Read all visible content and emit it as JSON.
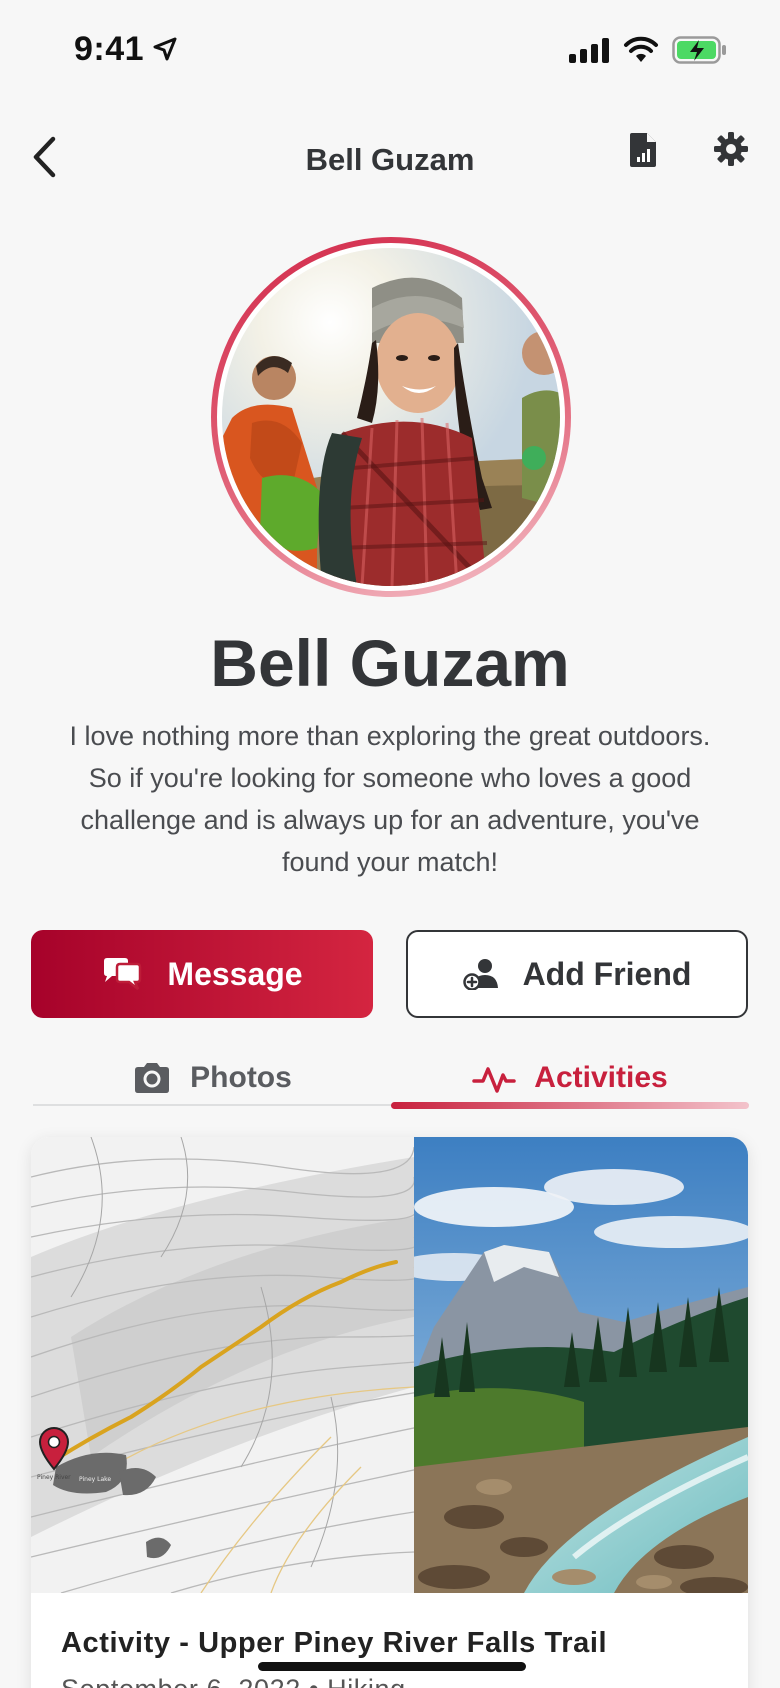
{
  "status_bar": {
    "time": "9:41"
  },
  "nav": {
    "title": "Bell Guzam"
  },
  "profile": {
    "name": "Bell Guzam",
    "bio": "I love nothing more than exploring the great outdoors. So if you're looking for someone who loves a good challenge and is always up for an adventure, you've found your match!"
  },
  "actions": {
    "message_label": "Message",
    "add_friend_label": "Add Friend"
  },
  "tabs": [
    {
      "label": "Photos",
      "icon": "camera-icon",
      "active": false
    },
    {
      "label": "Activities",
      "icon": "activity-pulse-icon",
      "active": true
    }
  ],
  "activity_card": {
    "title": "Activity - Upper Piney River Falls Trail",
    "subtitle": "September 6, 2022 • Hiking",
    "map_labels": [
      "Piney River",
      "Piney Lake"
    ]
  },
  "colors": {
    "accent": "#c8203d",
    "accent_dark": "#a6022a",
    "text": "#333538",
    "background": "#f7f7f7",
    "trail": "#d9a31f",
    "battery_fill": "#4cd964"
  }
}
